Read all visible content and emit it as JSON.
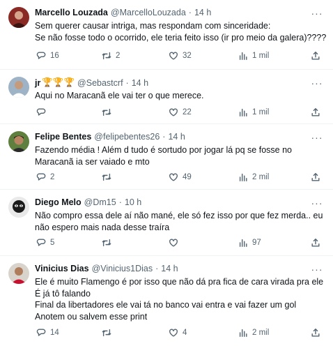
{
  "tweets": [
    {
      "name": "Marcello Louzada",
      "handle": "@MarcelloLouzada",
      "dot": "·",
      "time": "14 h",
      "lines": [
        "Sem querer causar intriga, mas respondam com sinceridade:",
        "Se não fosse todo o ocorrido, ele teria feito isso (ir pro meio da galera)????"
      ],
      "replies": "16",
      "retweets": "2",
      "likes": "32",
      "views": "1 mil"
    },
    {
      "name": "jr",
      "name_emojis": "🏆🏆🏆",
      "handle": "@Sebastcrf",
      "dot": "·",
      "time": "14 h",
      "lines": [
        "Aqui no Maracanã ele vai ter o que merece."
      ],
      "replies": "",
      "retweets": "",
      "likes": "22",
      "views": "1 mil"
    },
    {
      "name": "Felipe Bentes",
      "handle": "@felipebentes26",
      "dot": "·",
      "time": "14 h",
      "lines": [
        "Fazendo média ! Além d tudo é sortudo por jogar lá pq se fosse no",
        "Maracanã ia ser vaiado e mto"
      ],
      "replies": "2",
      "retweets": "",
      "likes": "49",
      "views": "2 mil"
    },
    {
      "name": "Diego Melo",
      "handle": "@Dm15",
      "dot": "·",
      "time": "10 h",
      "lines": [
        "Não compro essa dele aí não mané, ele só fez isso por que fez merda.. eu",
        "não espero mais nada desse traíra"
      ],
      "replies": "5",
      "retweets": "",
      "likes": "",
      "views": "97"
    },
    {
      "name": "Vinicius Dias",
      "handle": "@Vinicius1Dias",
      "dot": "·",
      "time": "14 h",
      "lines": [
        "Ele é muito Flamengo é por isso que não dá pra fica de cara virada pra ele",
        "É já tô falando",
        "Final da libertadores ele vai tá no banco vai entra e vai fazer um gol",
        "Anotem ou salvem esse print"
      ],
      "replies": "14",
      "retweets": "",
      "likes": "4",
      "views": "2 mil"
    }
  ],
  "more_glyph": "···",
  "icons": [
    "reply-icon",
    "retweet-icon",
    "like-icon",
    "views-icon",
    "share-icon",
    "more-icon"
  ],
  "colors": {
    "text": "#0f1419",
    "secondary": "#536471",
    "divider": "#eff3f4"
  }
}
